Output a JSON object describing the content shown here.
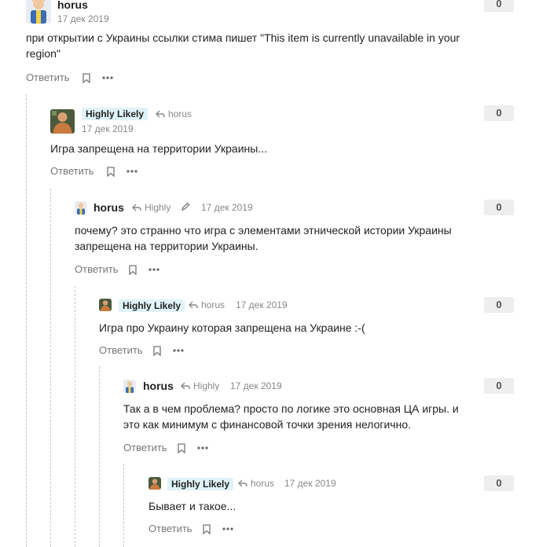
{
  "comments": [
    {
      "author": "horus",
      "date": "17 дек 2019",
      "text": "при открытии с Украины ссылки стима пишет \"This item is currently unavailable in your region\"",
      "reply": "Ответить",
      "score": "0"
    },
    {
      "author": "Highly Likely",
      "reply_to": "horus",
      "date": "17 дек 2019",
      "text": "Игра запрещена на территории Украины...",
      "reply": "Ответить",
      "score": "0"
    },
    {
      "author": "horus",
      "reply_to": "Highly",
      "date": "17 дек 2019",
      "text": "почему? это странно что игра с элементами этнической истории Украины запрещена на территории Украины.",
      "reply": "Ответить",
      "score": "0"
    },
    {
      "author": "Highly Likely",
      "reply_to": "horus",
      "date": "17 дек 2019",
      "text": "Игра про Украину которая запрещена на Украине :-(",
      "reply": "Ответить",
      "score": "0"
    },
    {
      "author": "horus",
      "reply_to": "Highly",
      "date": "17 дек 2019",
      "text": "Так а в чем проблема? просто по логике это основная ЦА игры. и это как минимум с финансовой точки зрения нелогично.",
      "reply": "Ответить",
      "score": "0"
    },
    {
      "author": "Highly Likely",
      "reply_to": "horus",
      "date": "17 дек 2019",
      "text": "Бывает и такое...",
      "reply": "Ответить",
      "score": "0"
    }
  ],
  "icons": {
    "reply_arrow": "reply-arrow-icon",
    "edit": "pencil-icon",
    "bookmark": "bookmark-icon",
    "more": "more-dots-icon"
  },
  "colors": {
    "author_highlight": "#dff3f8",
    "score_bg": "#eeeeee",
    "thread_line": "#c9c9c9"
  }
}
